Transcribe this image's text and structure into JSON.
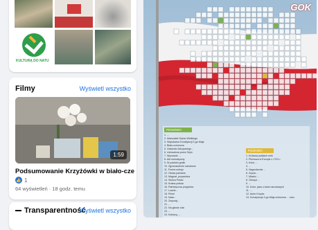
{
  "photos": {
    "album_label": "KULTURĄ DO NATU"
  },
  "films": {
    "title": "Filmy",
    "see_all": "Wyświetl wszystko",
    "video": {
      "title": "Podsumowanie Krzyżówki w biało-czerw...",
      "duration": "1:59",
      "likes": "1",
      "meta": "64 wyświetleń · 18 godz. temu"
    }
  },
  "transparency": {
    "title": "Transparentność",
    "see_all": "Wyświetl wszystko"
  },
  "poster": {
    "logo": "GOK",
    "clues_left_header": "PIONOWO",
    "clues_right_header": "POZIOMO",
    "clues_left": [
      "1. ...",
      "2. Marszałek Sejmu Wielkiego",
      "3. Współautor Konstytucji 3-go Maja",
      "4. Biało-czerwona",
      "5. Gwiazda Zakopanego...",
      "6. Uchwalona przez Sejm",
      "7. Wyznanie ...",
      "8. Akt normatywny",
      "9. W polskim godle",
      "10. Zgromadzenie narodowe",
      "11. Forma ustroju",
      "12. Głowa państwa",
      "13. Magnat, przywódca",
      "14. Stolica Polski",
      "15. Kraina polska",
      "16. Patriotyczna przypinka",
      "17. Ludzie...",
      "18. Pieśń",
      "19. Nasz...",
      "20. Zwyczaj...",
      "21. ...",
      "22. Na głowie orła",
      "23. ...",
      "24. Kotwicą, ..."
    ],
    "clues_right": [
      "1. Królowa polskich rzek",
      "2. Pierwsza w Europie z 1791 r.",
      "3. Kolor ...",
      "4. ...",
      "5. Nagrodzenie ...",
      "6. Zrywa...",
      "7. Miasto ...",
      "8. Obrzęd ...",
      "9. ...",
      "10. Kolor, jaka u barw narodowych",
      "11. ...",
      "12. Autor Krzyża",
      "13. Konstytucja 3-go Maja zniesiona ... roku"
    ]
  }
}
